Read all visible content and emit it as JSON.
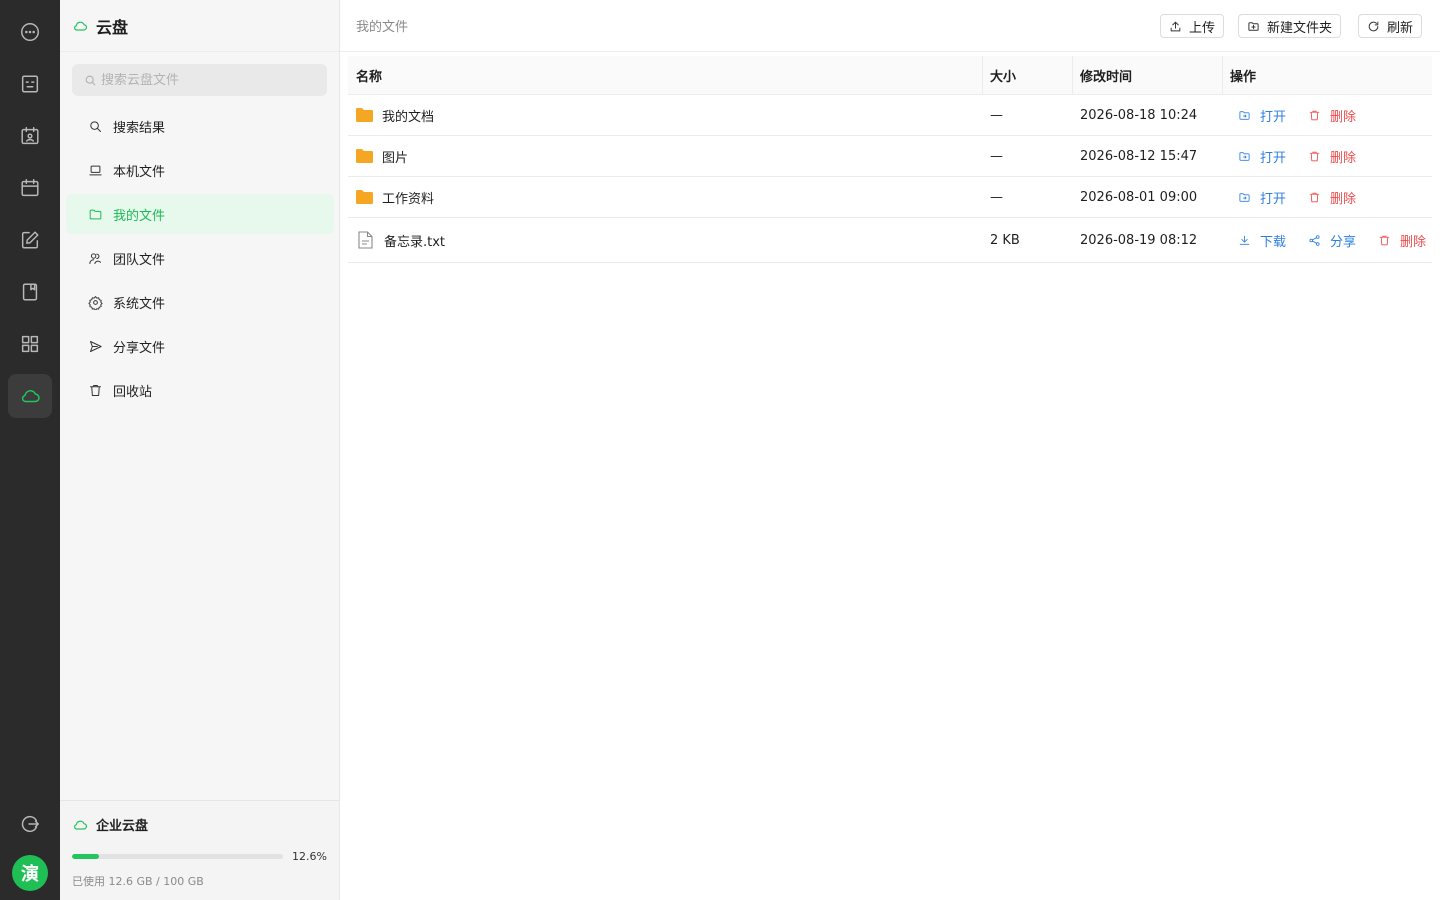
{
  "rail": {
    "icons": [
      "chat-icon",
      "contacts-icon",
      "meeting-icon",
      "calendar-icon",
      "edit-icon",
      "bookmark-icon",
      "apps-icon",
      "cloud-icon"
    ],
    "active": "cloud-icon",
    "avatar": "演"
  },
  "sidebar": {
    "title": "云盘",
    "search_placeholder": "搜索云盘文件",
    "items": [
      {
        "label": "搜索结果",
        "icon": "search-icon"
      },
      {
        "label": "本机文件",
        "icon": "laptop-icon"
      },
      {
        "label": "我的文件",
        "icon": "folder-icon",
        "active": true
      },
      {
        "label": "团队文件",
        "icon": "team-icon"
      },
      {
        "label": "系统文件",
        "icon": "gear-icon"
      },
      {
        "label": "分享文件",
        "icon": "send-icon"
      },
      {
        "label": "回收站",
        "icon": "trash-icon"
      }
    ],
    "storage": {
      "title": "企业云盘",
      "percent_label": "12.6%",
      "percent": 0.126,
      "used_label": "已使用 12.6 GB / 100 GB"
    }
  },
  "main": {
    "breadcrumb": "我的文件",
    "toolbar": {
      "upload": "上传",
      "new_folder": "新建文件夹",
      "refresh": "刷新"
    },
    "columns": {
      "name": "名称",
      "size": "大小",
      "modified": "修改时间",
      "actions": "操作"
    },
    "rows": [
      {
        "name": "我的文档",
        "type": "folder",
        "size": "—",
        "modified": "2026-08-18 10:24",
        "actions": [
          "打开",
          "删除"
        ]
      },
      {
        "name": "图片",
        "type": "folder",
        "size": "—",
        "modified": "2026-08-12 15:47",
        "actions": [
          "打开",
          "删除"
        ]
      },
      {
        "name": "工作资料",
        "type": "folder",
        "size": "—",
        "modified": "2026-08-01 09:00",
        "actions": [
          "打开",
          "删除"
        ]
      },
      {
        "name": "备忘录.txt",
        "type": "file",
        "size": "2 KB",
        "modified": "2026-08-19 08:12",
        "actions": [
          "下载",
          "分享",
          "删除"
        ]
      }
    ]
  },
  "colors": {
    "accent": "#22c55e",
    "link": "#2f7fe0",
    "danger": "#ee4b4b",
    "folder": "#f5a623"
  }
}
